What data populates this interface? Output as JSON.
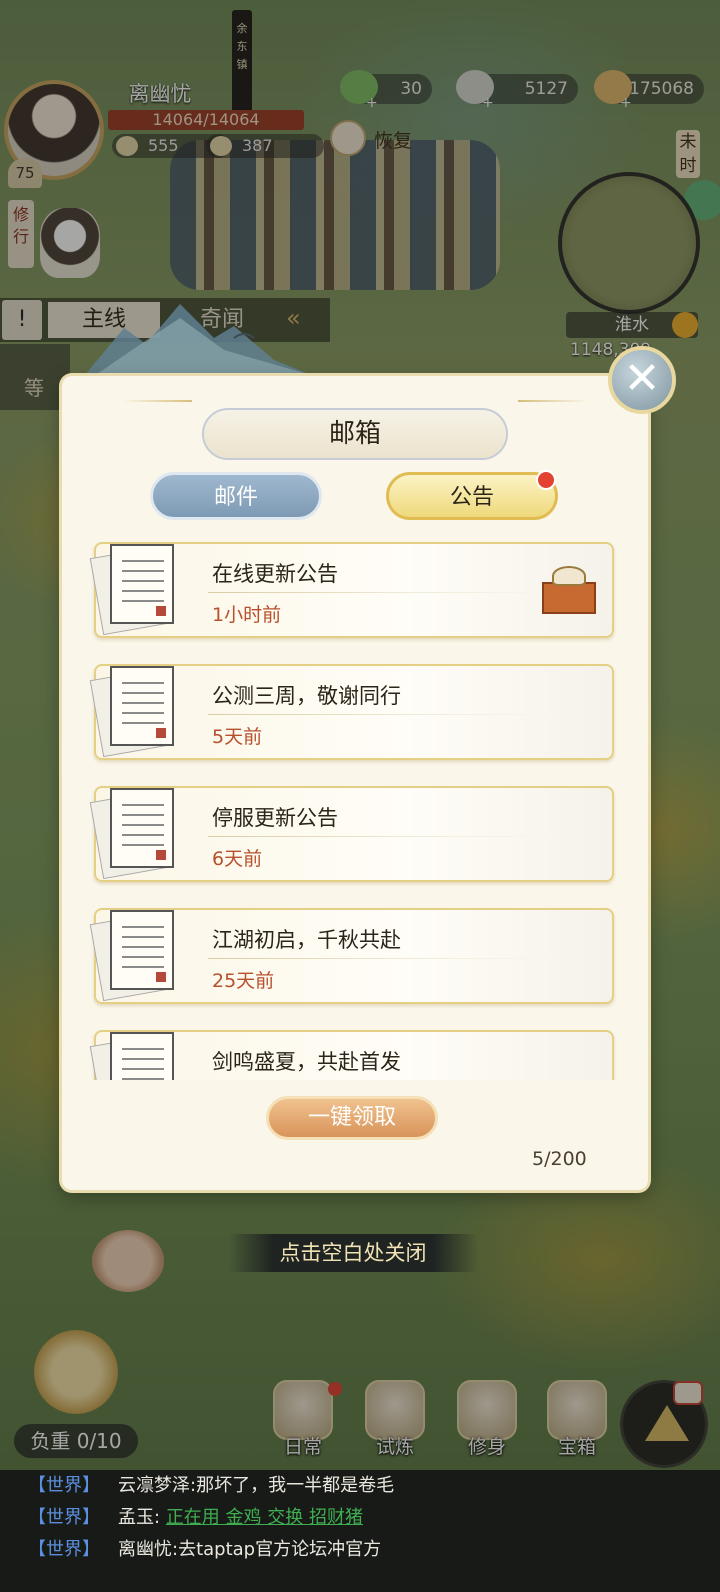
{
  "town": {
    "name": "余东镇"
  },
  "player": {
    "name": "离幽忧",
    "hp": "14064/14064",
    "level": "75",
    "stat_a": "555",
    "stat_b": "387",
    "cultivate_label": "修行"
  },
  "currency": [
    {
      "icon": "jade-pile-icon",
      "value": "30"
    },
    {
      "icon": "silver-ingot-icon",
      "value": "5127"
    },
    {
      "icon": "copper-coin-icon",
      "value": "175068"
    }
  ],
  "recover_label": "恢复",
  "time_label": "未时",
  "minimap": {
    "location": "淮水",
    "coords": "1148,309"
  },
  "quests": {
    "main_tab": "主线",
    "side_tab": "奇闻",
    "card_text": "等"
  },
  "modal": {
    "title": "邮箱",
    "tabs": [
      {
        "label": "邮件",
        "active": false
      },
      {
        "label": "公告",
        "active": true,
        "has_badge": true
      }
    ],
    "items": [
      {
        "title": "在线更新公告",
        "time": "1小时前",
        "has_gift": true
      },
      {
        "title": "公测三周，敬谢同行",
        "time": "5天前",
        "has_gift": false
      },
      {
        "title": "停服更新公告",
        "time": "6天前",
        "has_gift": false
      },
      {
        "title": "江湖初启，千秋共赴",
        "time": "25天前",
        "has_gift": false
      },
      {
        "title": "剑鸣盛夏，共赴首发",
        "time": "",
        "has_gift": false
      }
    ],
    "claim_all_label": "一键领取",
    "count": "5/200",
    "close_hint": "点击空白处关闭"
  },
  "load": "负重 0/10",
  "nav": [
    {
      "label": "日常",
      "icon": "daily-scroll-icon",
      "badge": true
    },
    {
      "label": "试炼",
      "icon": "trial-hat-icon",
      "badge": false
    },
    {
      "label": "修身",
      "icon": "cultivation-book-icon",
      "badge": false
    },
    {
      "label": "宝箱",
      "icon": "treasure-chest-icon",
      "badge": false
    }
  ],
  "chat": [
    {
      "channel": "【世界】",
      "name": "云凛梦泽:",
      "text": "那坏了，我一半都是卷毛",
      "link": ""
    },
    {
      "channel": "【世界】",
      "name": "孟玉:",
      "text": "",
      "link": "正在用 金鸡 交换 招财猪"
    },
    {
      "channel": "【世界】",
      "name": "离幽忧:",
      "text": "去taptap官方论坛冲官方",
      "link": ""
    }
  ],
  "colors": {
    "accent_gold": "#e0bc52",
    "time_red": "#b6502d",
    "chat_channel": "#5b8fe0",
    "chat_link": "#3fae51"
  }
}
